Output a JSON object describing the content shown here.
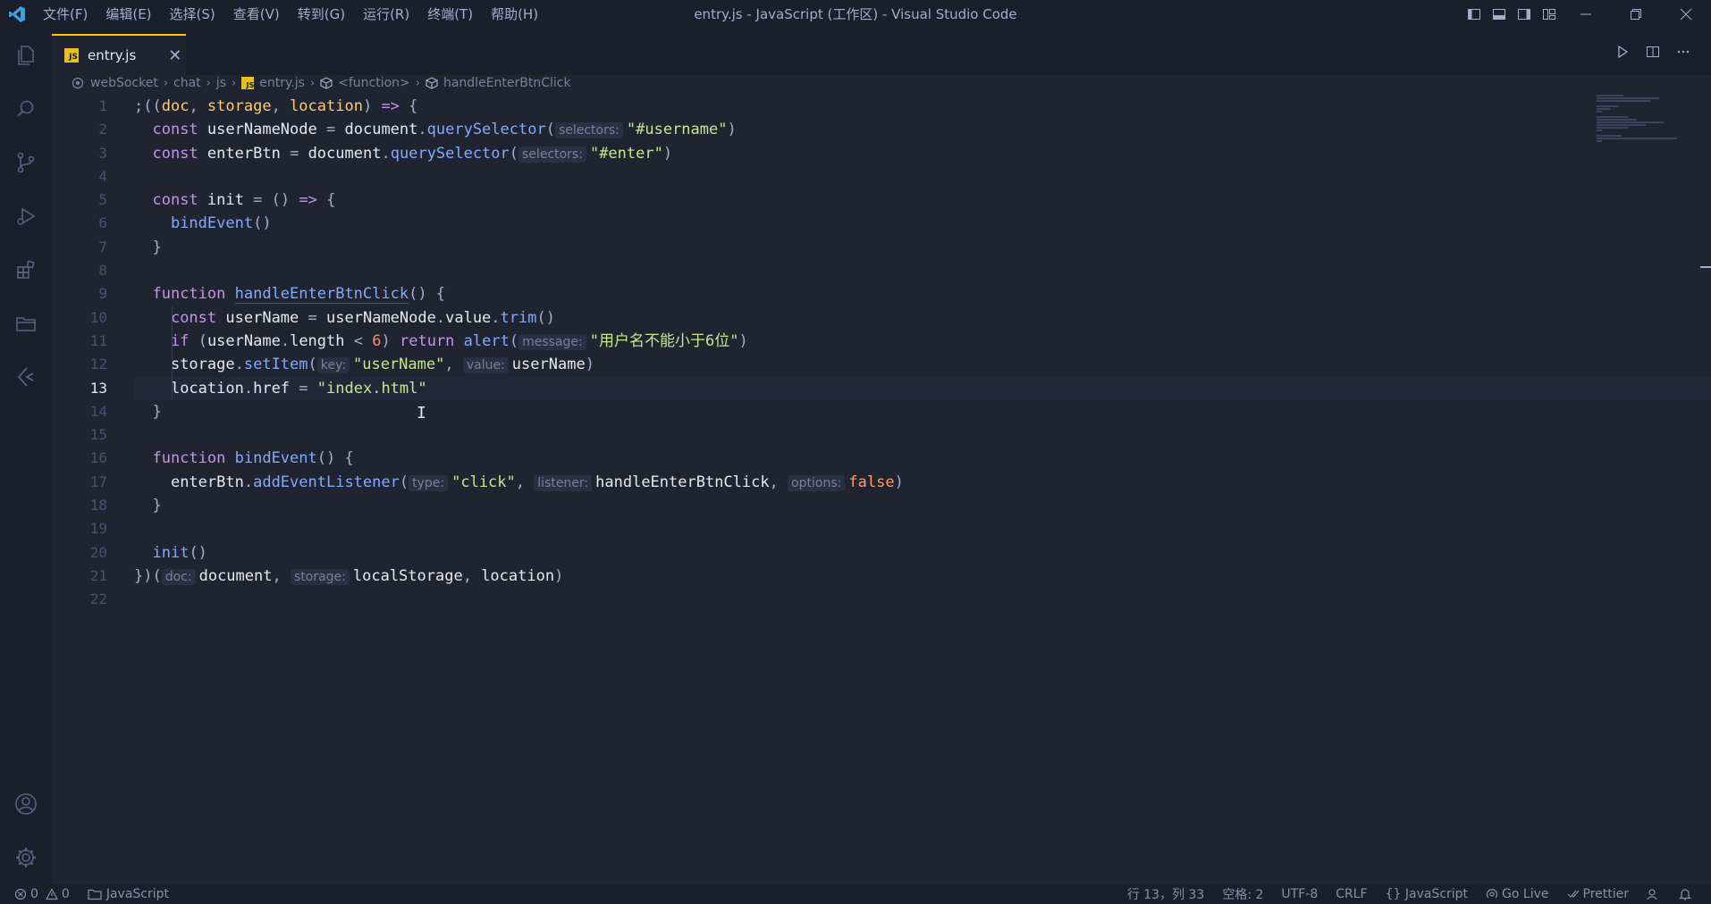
{
  "titlebar": {
    "menu": [
      "文件(F)",
      "编辑(E)",
      "选择(S)",
      "查看(V)",
      "转到(G)",
      "运行(R)",
      "终端(T)",
      "帮助(H)"
    ],
    "window_title": "entry.js - JavaScript (工作区) - Visual Studio Code"
  },
  "tab": {
    "badge": "JS",
    "label": "entry.js",
    "close": "✕"
  },
  "breadcrumb": {
    "items": [
      "webSocket",
      "chat",
      "js",
      "entry.js",
      "<function>",
      "handleEnterBtnClick"
    ]
  },
  "editor": {
    "line_numbers": [
      "1",
      "2",
      "3",
      "4",
      "5",
      "6",
      "7",
      "8",
      "9",
      "10",
      "11",
      "12",
      "13",
      "14",
      "15",
      "16",
      "17",
      "18",
      "19",
      "20",
      "21",
      "22"
    ],
    "current_line": 13,
    "hints": {
      "selectors": "selectors:",
      "message": "message:",
      "key": "key:",
      "value": "value:",
      "type": "type:",
      "listener": "listener:",
      "options": "options:",
      "doc": "doc:",
      "storage": "storage:"
    },
    "strings": {
      "username_sel": "\"#username\"",
      "enter_sel": "\"#enter\"",
      "alert_msg": "\"用户名不能小于6位\"",
      "username_key": "\"userName\"",
      "href": "\"index.html\"",
      "click": "\"click\""
    }
  },
  "statusbar": {
    "errors": "0",
    "warnings": "0",
    "folder": "JavaScript",
    "position": "行 13，列 33",
    "spaces": "空格: 2",
    "encoding": "UTF-8",
    "eol": "CRLF",
    "language": "{} JavaScript",
    "golive": "Go Live",
    "prettier": "Prettier"
  }
}
